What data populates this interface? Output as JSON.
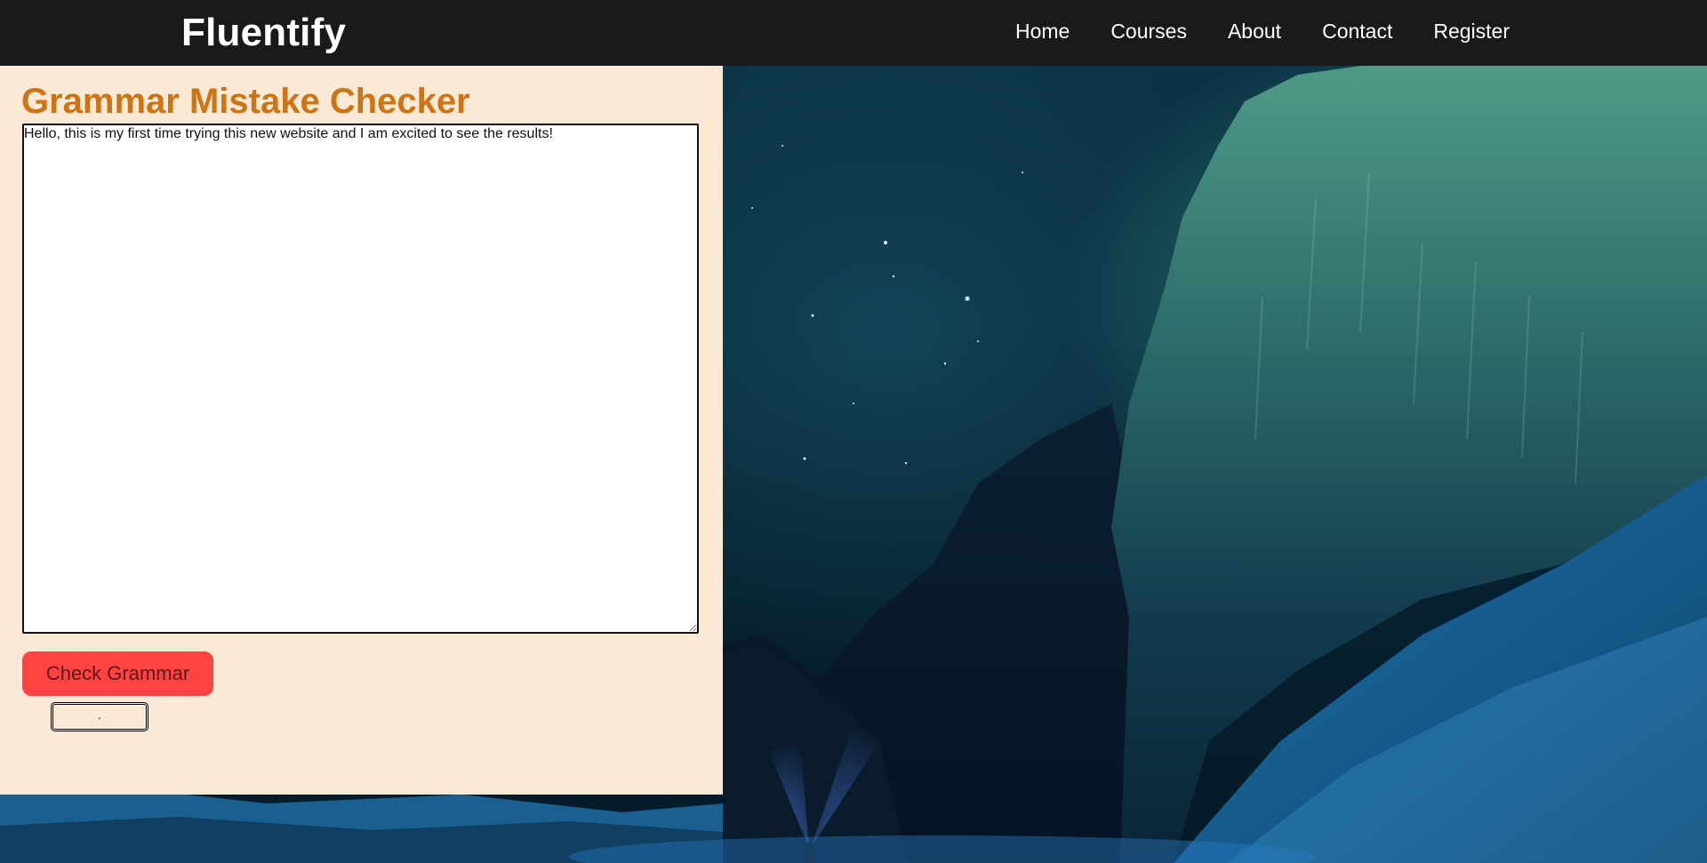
{
  "nav": {
    "brand": "Fluentify",
    "links": [
      {
        "label": "Home"
      },
      {
        "label": "Courses"
      },
      {
        "label": "About"
      },
      {
        "label": "Contact"
      },
      {
        "label": "Register"
      }
    ]
  },
  "checker": {
    "title": "Grammar Mistake Checker",
    "input_value": "Hello, this is my first time trying this new website and I am excited to see the results!",
    "button_label": "Check Grammar",
    "result_text": "."
  },
  "colors": {
    "navbar_bg": "#1a1a1a",
    "panel_bg": "#fae9d4",
    "title_color": "#cc7416",
    "button_bg": "#ff4242"
  }
}
